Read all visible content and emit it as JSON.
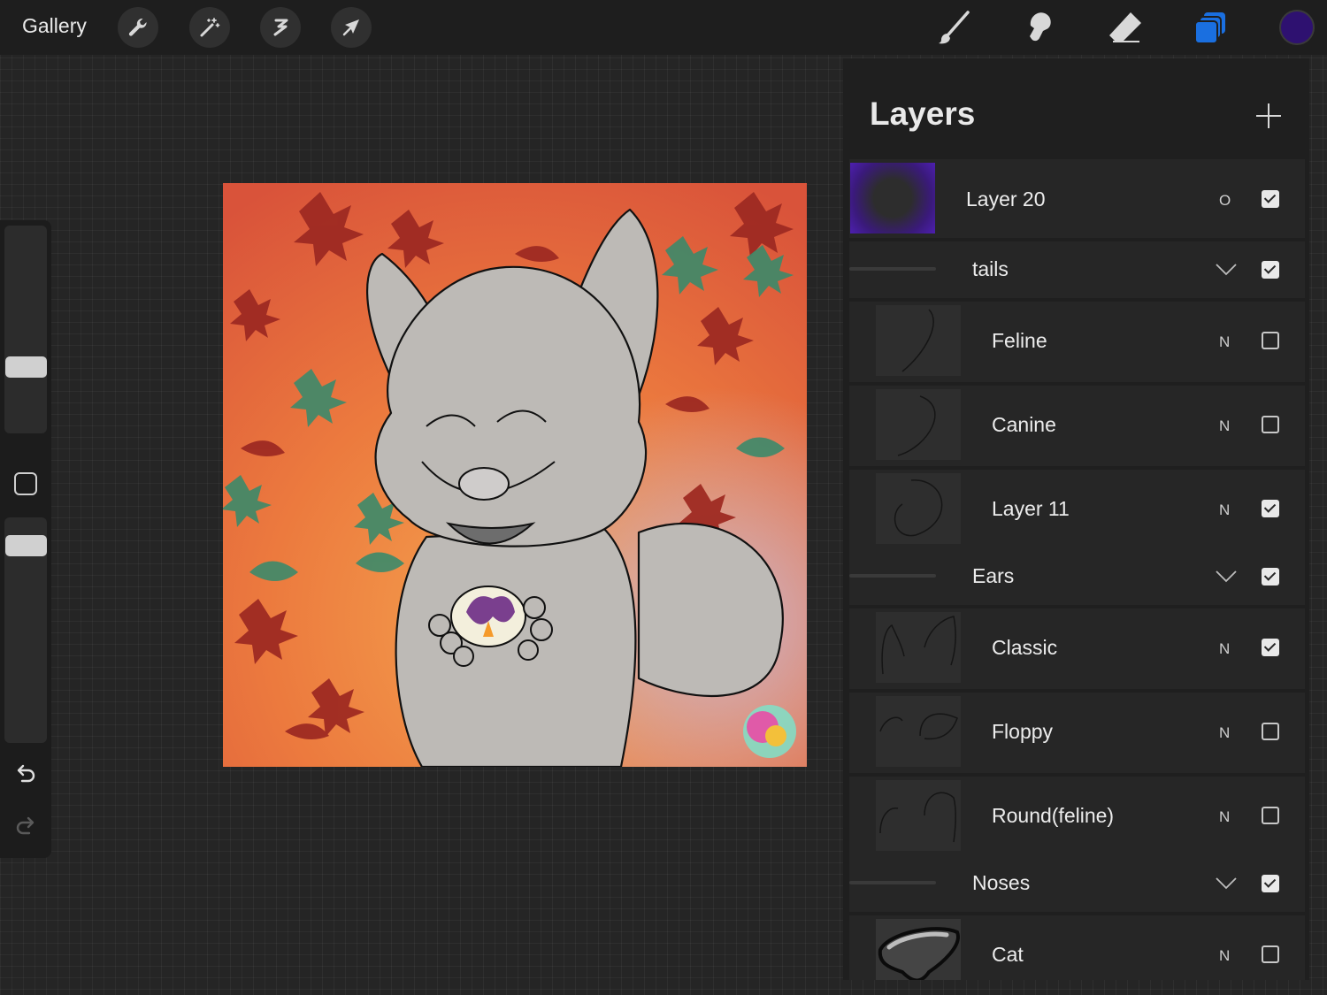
{
  "toolbar": {
    "gallery_label": "Gallery",
    "left_tools": [
      "wrench-icon",
      "magic-wand-icon",
      "selection-icon",
      "transform-arrow-icon"
    ],
    "right_tools": [
      "brush-icon",
      "smudge-icon",
      "eraser-icon",
      "layers-icon"
    ],
    "active_tool": "layers-icon",
    "accent_color": "#1a6fe0",
    "current_color": "#2e1170"
  },
  "sidebar": {
    "brush_size": 0.38,
    "opacity": 0.55,
    "icons": [
      "modify-square-icon",
      "undo-icon",
      "redo-icon"
    ]
  },
  "layers_panel": {
    "title": "Layers",
    "add_icon": "plus-icon",
    "rows": [
      {
        "type": "layer",
        "name": "Layer 20",
        "blend": "O",
        "visible": true
      },
      {
        "type": "group",
        "name": "tails",
        "visible": true,
        "expanded": true
      },
      {
        "type": "layer",
        "name": "Feline",
        "blend": "N",
        "visible": false
      },
      {
        "type": "layer",
        "name": "Canine",
        "blend": "N",
        "visible": false
      },
      {
        "type": "layer",
        "name": "Layer 11",
        "blend": "N",
        "visible": true
      },
      {
        "type": "group",
        "name": "Ears",
        "visible": true,
        "expanded": true
      },
      {
        "type": "layer",
        "name": "Classic",
        "blend": "N",
        "visible": true
      },
      {
        "type": "layer",
        "name": "Floppy",
        "blend": "N",
        "visible": false
      },
      {
        "type": "layer",
        "name": "Round(feline)",
        "blend": "N",
        "visible": false
      },
      {
        "type": "group",
        "name": "Noses",
        "visible": true,
        "expanded": true
      },
      {
        "type": "layer",
        "name": "Cat",
        "blend": "N",
        "visible": false
      }
    ]
  }
}
